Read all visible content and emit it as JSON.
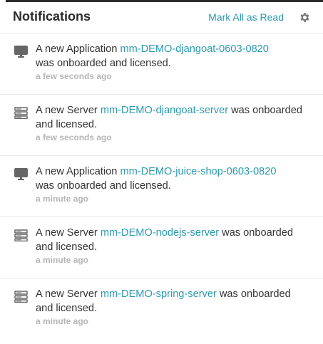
{
  "header": {
    "title": "Notifications",
    "mark_all_label": "Mark All as Read",
    "settings_icon": "gear-icon"
  },
  "notifications": [
    {
      "icon": "monitor-icon",
      "prefix": "A new Application ",
      "link": "mm-DEMO-djangoat-0603-0820",
      "suffix": "was onboarded and licensed.",
      "time": "a few seconds ago"
    },
    {
      "icon": "server-icon",
      "prefix": "A new Server ",
      "link": "mm-DEMO-djangoat-server",
      "suffix": " was onboarded and licensed.",
      "time": "a few seconds ago"
    },
    {
      "icon": "monitor-icon",
      "prefix": "A new Application ",
      "link": "mm-DEMO-juice-shop-0603-0820",
      "suffix": "was onboarded and licensed.",
      "time": "a minute ago"
    },
    {
      "icon": "server-icon",
      "prefix": "A new Server ",
      "link": "mm-DEMO-nodejs-server",
      "suffix": " was onboarded and licensed.",
      "time": "a minute ago"
    },
    {
      "icon": "server-icon",
      "prefix": "A new Server ",
      "link": "mm-DEMO-spring-server",
      "suffix": " was onboarded and licensed.",
      "time": "a minute ago"
    }
  ],
  "colors": {
    "accent": "#2a9ab0",
    "text": "#333333",
    "muted": "#b5b5b5",
    "icon": "#666666"
  }
}
